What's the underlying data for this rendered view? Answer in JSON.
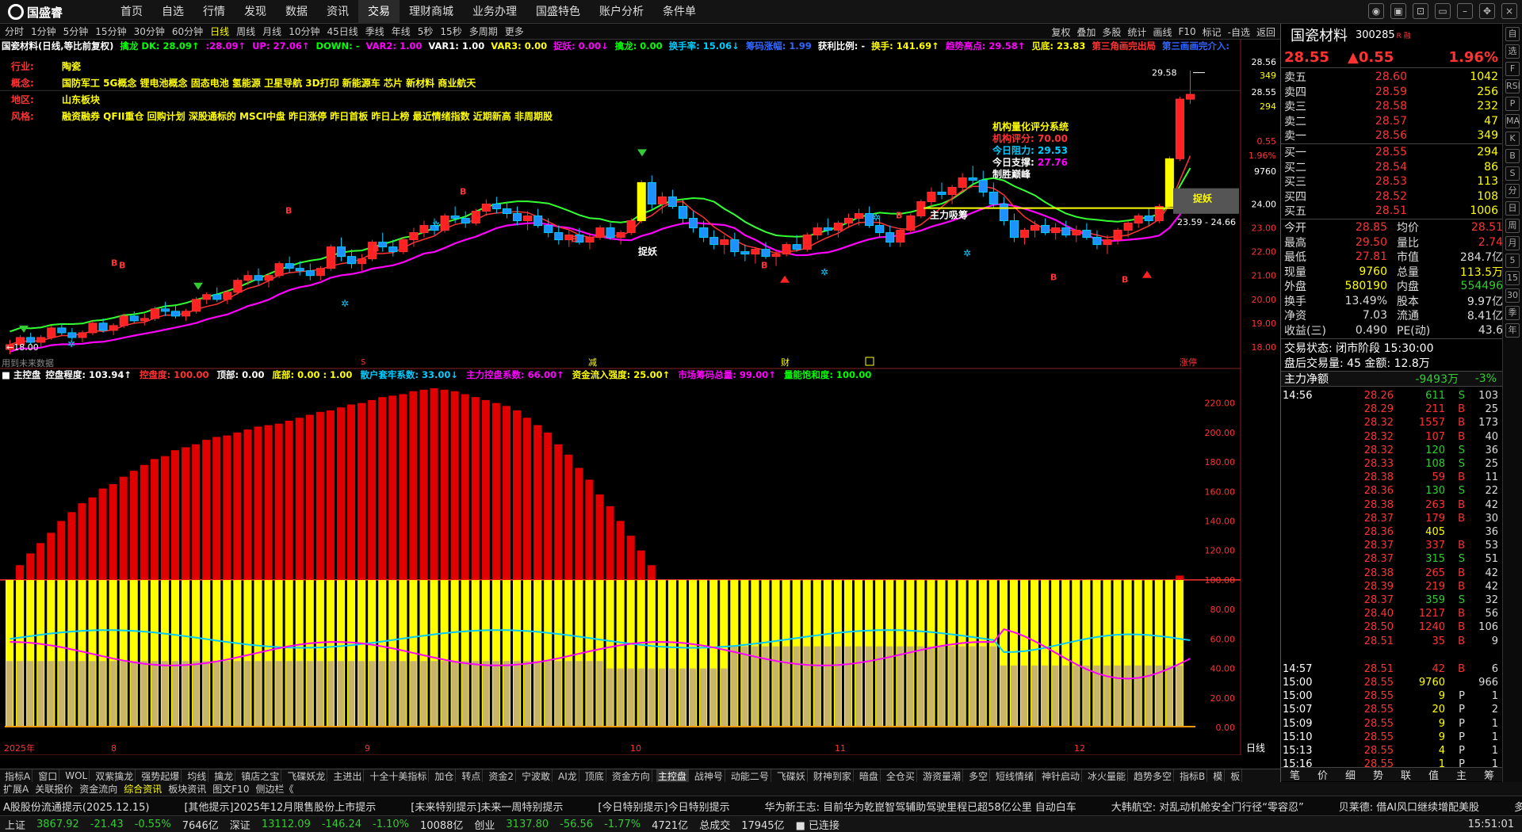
{
  "app": {
    "name": "国盛睿"
  },
  "menu": [
    "首页",
    "自选",
    "行情",
    "发现",
    "数据",
    "资讯",
    "交易",
    "理财商城",
    "业务办理",
    "国盛特色",
    "账户分析",
    "条件单"
  ],
  "menu_active": "交易",
  "periods": [
    "分时",
    "1分钟",
    "5分钟",
    "15分钟",
    "30分钟",
    "60分钟",
    "日线",
    "周线",
    "月线",
    "10分钟",
    "45日线",
    "季线",
    "年线",
    "5秒",
    "15秒",
    "多周期",
    "更多"
  ],
  "period_active": "日线",
  "chart_buttons": [
    "复权",
    "叠加",
    "多股",
    "统计",
    "画线",
    "F10",
    "标记",
    "-自选",
    "返回"
  ],
  "chart_title": "国瓷材料(日线,等比前复权)",
  "indicators": [
    {
      "t": "擒龙 DK: 28.09↑",
      "c": "#0f0"
    },
    {
      "t": ":28.09↑",
      "c": "#f0f"
    },
    {
      "t": "UP: 27.06↑",
      "c": "#f0f"
    },
    {
      "t": "DOWN: -",
      "c": "#0f0"
    },
    {
      "t": "VAR2: 1.00",
      "c": "#f0f"
    },
    {
      "t": "VAR1: 1.00",
      "c": "#fff"
    },
    {
      "t": "VAR3: 0.00",
      "c": "#ff0"
    },
    {
      "t": "捉妖: 0.00↓",
      "c": "#f0f"
    },
    {
      "t": "擒龙: 0.00",
      "c": "#0f0"
    },
    {
      "t": "换手率: 15.06↓",
      "c": "#0cf"
    },
    {
      "t": "筹码涨幅: 1.99",
      "c": "#36f"
    },
    {
      "t": "获利比例: -",
      "c": "#fff"
    },
    {
      "t": "换手: 141.69↑",
      "c": "#ff0"
    },
    {
      "t": "趋势高点: 29.58↑",
      "c": "#f0f"
    },
    {
      "t": "见底: 23.83",
      "c": "#ff0"
    },
    {
      "t": "第三角画完出局",
      "c": "#f33"
    },
    {
      "t": "第三画画完介入:",
      "c": "#36f"
    }
  ],
  "stock_info": [
    {
      "k": "行业:",
      "v": "陶瓷"
    },
    {
      "k": "概念:",
      "v": "国防军工 5G概念 锂电池概念 固态电池 氢能源 卫星导航 3D打印 新能源车 芯片 新材料 商业航天"
    },
    {
      "k": "地区:",
      "v": "山东板块"
    },
    {
      "k": "风格:",
      "v": "融资融券 QFII重仓 回购计划 深股通标的 MSCI中盘 昨日涨停 昨日首板 昨日上榜 最近情绪指数 近期新高 非周期股"
    }
  ],
  "rating": {
    "title": "机构量化评分系统",
    "score_label": "机构评分:",
    "score": "70.00",
    "res_label": "今日阻力:",
    "res": "29.53",
    "sup_label": "今日支撑:",
    "sup": "27.76",
    "name": "制胜巅峰"
  },
  "annotations": {
    "main_lab": "主力吸筹",
    "zy": "捉妖",
    "high": "29.58",
    "low_left": "18.00",
    "range": "23.59 - 24.66",
    "future": "用到未来数据",
    "zt": "涨停",
    "jian": "减",
    "cai": "财"
  },
  "sub_title": "主控盘",
  "sub_indicators": [
    {
      "t": "控盘程度: 103.94↑",
      "c": "#fff"
    },
    {
      "t": "控盘度: 100.00",
      "c": "#f33"
    },
    {
      "t": "顶部: 0.00",
      "c": "#fff"
    },
    {
      "t": "底部: 0.00 : 1.00",
      "c": "#ff0"
    },
    {
      "t": "散户套牢系数: 33.00↓",
      "c": "#0cf"
    },
    {
      "t": "主力控盘系数: 66.00↑",
      "c": "#f0f"
    },
    {
      "t": "资金流入强度: 25.00↑",
      "c": "#ff0"
    },
    {
      "t": "市场筹码总量: 99.00↑",
      "c": "#f0f"
    },
    {
      "t": "量能饱和度: 100.00",
      "c": "#0f0"
    }
  ],
  "price_axis": [
    "28.56",
    "349",
    "28.55",
    "294",
    "0.55",
    "1.96%",
    "9760",
    "24.00",
    "23.00",
    "22.00",
    "21.00",
    "20.00",
    "19.00",
    "18.00"
  ],
  "sub_axis": [
    "220.00",
    "200.00",
    "180.00",
    "160.00",
    "140.00",
    "120.00",
    "100.00",
    "80.00",
    "60.00",
    "40.00",
    "20.00",
    "0.00"
  ],
  "dates": [
    "2025年",
    "8",
    "9",
    "10",
    "11",
    "12"
  ],
  "period_label": "日线",
  "chart_data": {
    "type": "candlestick",
    "title": "国瓷材料(日线,等比前复权)",
    "ylim": [
      17.6,
      29.9
    ],
    "ohlc": [
      [
        17.9,
        18.3,
        17.7,
        18.1
      ],
      [
        18.1,
        18.5,
        18,
        18.4
      ],
      [
        18.4,
        18.6,
        18.1,
        18.2
      ],
      [
        18.2,
        18.5,
        18,
        18.4
      ],
      [
        18.4,
        18.9,
        18.3,
        18.8
      ],
      [
        18.8,
        19,
        18.5,
        18.6
      ],
      [
        18.6,
        18.8,
        18.3,
        18.4
      ],
      [
        18.4,
        18.7,
        18.2,
        18.6
      ],
      [
        18.6,
        19.1,
        18.5,
        19
      ],
      [
        19,
        19.2,
        18.6,
        18.7
      ],
      [
        18.7,
        19,
        18.5,
        18.9
      ],
      [
        18.9,
        19.4,
        18.8,
        19.3
      ],
      [
        19.3,
        19.5,
        19,
        19.1
      ],
      [
        19.1,
        19.4,
        18.9,
        19.2
      ],
      [
        19.2,
        19.7,
        19.1,
        19.6
      ],
      [
        19.6,
        19.9,
        19.3,
        19.5
      ],
      [
        19.5,
        19.8,
        19.2,
        19.3
      ],
      [
        19.3,
        19.6,
        19.1,
        19.5
      ],
      [
        19.5,
        20.1,
        19.4,
        20
      ],
      [
        20,
        20.3,
        19.8,
        20.2
      ],
      [
        20.2,
        20.5,
        19.9,
        20
      ],
      [
        20,
        20.4,
        19.8,
        20.3
      ],
      [
        20.3,
        20.9,
        20.2,
        20.8
      ],
      [
        20.8,
        21.2,
        20.6,
        21
      ],
      [
        21,
        21.3,
        20.6,
        20.8
      ],
      [
        20.8,
        21.1,
        20.5,
        21
      ],
      [
        21,
        21.6,
        20.9,
        21.5
      ],
      [
        21.5,
        21.8,
        21.1,
        21.3
      ],
      [
        21.3,
        21.6,
        21,
        21.2
      ],
      [
        21.2,
        21.5,
        20.8,
        21
      ],
      [
        21,
        21.4,
        20.8,
        21.3
      ],
      [
        21.3,
        22.3,
        21.2,
        22.2
      ],
      [
        22.2,
        22.6,
        21.6,
        21.8
      ],
      [
        21.8,
        22.1,
        21.3,
        21.5
      ],
      [
        21.5,
        21.9,
        21.2,
        21.7
      ],
      [
        21.7,
        22.5,
        21.6,
        22.4
      ],
      [
        22.4,
        22.8,
        22,
        22.2
      ],
      [
        22.2,
        22.5,
        21.8,
        22
      ],
      [
        22,
        22.6,
        21.9,
        22.5
      ],
      [
        22.5,
        23,
        22.2,
        22.8
      ],
      [
        22.8,
        23.3,
        22.6,
        23.1
      ],
      [
        23.1,
        23.4,
        22.7,
        22.9
      ],
      [
        22.9,
        23.6,
        22.8,
        23.5
      ],
      [
        23.5,
        23.9,
        23.2,
        23.4
      ],
      [
        23.4,
        23.7,
        23,
        23.2
      ],
      [
        23.2,
        23.8,
        23.1,
        23.7
      ],
      [
        23.7,
        24.2,
        23.5,
        24
      ],
      [
        24,
        24.3,
        23.6,
        23.8
      ],
      [
        23.8,
        24.1,
        23.4,
        23.6
      ],
      [
        23.6,
        23.9,
        23.1,
        23.3
      ],
      [
        23.3,
        23.7,
        22.9,
        23.5
      ],
      [
        23.5,
        23.8,
        23,
        23.1
      ],
      [
        23.1,
        23.4,
        22.6,
        22.8
      ],
      [
        22.8,
        23.1,
        22.3,
        22.5
      ],
      [
        22.5,
        22.9,
        22.2,
        22.7
      ],
      [
        22.7,
        23,
        22.3,
        22.4
      ],
      [
        22.4,
        22.8,
        22.1,
        22.6
      ],
      [
        22.6,
        23.1,
        22.5,
        23
      ],
      [
        23,
        23.2,
        22.5,
        22.6
      ],
      [
        22.6,
        22.9,
        22.3,
        22.8
      ],
      [
        22.8,
        23.4,
        22.7,
        23.3
      ],
      [
        23.3,
        25,
        23.2,
        24.9
      ],
      [
        24.9,
        25.2,
        23.8,
        24
      ],
      [
        24,
        24.5,
        23.6,
        24.3
      ],
      [
        24.3,
        24.6,
        23.8,
        23.9
      ],
      [
        23.9,
        24.2,
        23.2,
        23.4
      ],
      [
        23.4,
        23.7,
        22.8,
        23
      ],
      [
        23,
        23.3,
        22.4,
        22.6
      ],
      [
        22.6,
        22.9,
        22.1,
        22.3
      ],
      [
        22.3,
        22.7,
        21.9,
        22.5
      ],
      [
        22.5,
        22.8,
        21.8,
        22
      ],
      [
        22,
        22.3,
        21.6,
        21.9
      ],
      [
        21.9,
        22.2,
        21.5,
        22.1
      ],
      [
        22.1,
        22.4,
        21.7,
        21.8
      ],
      [
        21.8,
        22.1,
        21.4,
        21.9
      ],
      [
        21.9,
        22.4,
        21.8,
        22.3
      ],
      [
        22.3,
        22.7,
        22,
        22.1
      ],
      [
        22.1,
        22.8,
        22,
        22.7
      ],
      [
        22.7,
        23.2,
        22.5,
        23
      ],
      [
        23,
        23.4,
        22.7,
        22.9
      ],
      [
        22.9,
        23.3,
        22.6,
        23.2
      ],
      [
        23.2,
        23.6,
        23,
        23.4
      ],
      [
        23.4,
        23.8,
        23.1,
        23.6
      ],
      [
        23.6,
        23.9,
        23,
        23.1
      ],
      [
        23.1,
        23.5,
        22.6,
        22.8
      ],
      [
        22.8,
        23.1,
        22.2,
        22.4
      ],
      [
        22.4,
        23,
        22.2,
        22.9
      ],
      [
        22.9,
        23.6,
        22.8,
        23.5
      ],
      [
        23.5,
        24.2,
        23.4,
        24.1
      ],
      [
        24.1,
        24.7,
        23.9,
        24.5
      ],
      [
        24.5,
        24.9,
        24.2,
        24.4
      ],
      [
        24.4,
        24.8,
        24,
        24.7
      ],
      [
        24.7,
        25.3,
        24.5,
        25.1
      ],
      [
        25.1,
        25.6,
        24.8,
        25
      ],
      [
        25,
        25.4,
        24.3,
        24.5
      ],
      [
        24.5,
        24.9,
        23.8,
        24
      ],
      [
        24,
        24.3,
        23.1,
        23.3
      ],
      [
        23.3,
        23.6,
        22.4,
        22.6
      ],
      [
        22.6,
        23,
        22.3,
        22.9
      ],
      [
        22.9,
        23.3,
        22.6,
        23.1
      ],
      [
        23.1,
        23.4,
        22.7,
        22.8
      ],
      [
        22.8,
        23.2,
        22.5,
        23
      ],
      [
        23,
        23.3,
        22.6,
        22.7
      ],
      [
        22.7,
        23.1,
        22.4,
        22.9
      ],
      [
        22.9,
        23.2,
        22.5,
        22.6
      ],
      [
        22.6,
        22.9,
        22.1,
        22.3
      ],
      [
        22.3,
        22.7,
        21.9,
        22.5
      ],
      [
        22.5,
        23,
        22.3,
        22.9
      ],
      [
        22.9,
        23.3,
        22.6,
        23.2
      ],
      [
        23.2,
        23.6,
        23,
        23.5
      ],
      [
        23.5,
        23.8,
        23.1,
        23.3
      ],
      [
        23.3,
        24,
        23.2,
        23.9
      ],
      [
        23.9,
        26,
        23.8,
        25.9
      ],
      [
        25.9,
        28.5,
        25.8,
        28.4
      ],
      [
        28.4,
        29.6,
        28.2,
        28.6
      ]
    ],
    "main_bars": [
      0,
      0,
      0,
      0,
      0,
      0,
      0,
      0,
      0,
      0,
      0,
      0,
      0,
      0,
      0,
      0,
      0,
      0,
      0,
      0,
      0,
      0,
      0,
      0,
      0,
      0,
      0,
      0,
      0,
      0,
      0,
      0,
      0,
      0,
      0,
      0,
      0,
      0,
      0,
      0,
      0,
      0,
      0,
      0,
      0,
      0,
      0,
      0,
      0,
      0,
      0,
      0,
      0,
      0,
      0,
      0,
      0,
      0,
      0,
      0,
      0,
      0,
      0,
      0,
      0,
      0,
      0,
      0,
      0,
      0,
      0,
      0,
      0,
      0,
      0,
      0,
      0,
      0,
      0,
      0,
      0,
      0,
      0,
      0,
      0,
      0,
      0,
      0,
      0,
      0,
      0,
      0,
      0,
      0,
      0,
      0,
      0,
      0,
      0,
      0,
      0,
      0,
      0,
      0,
      0,
      0,
      0,
      0,
      0,
      0,
      0,
      0,
      0,
      0,
      0
    ],
    "control_bars": [
      100,
      110,
      118,
      125,
      132,
      140,
      146,
      152,
      156,
      162,
      165,
      170,
      174,
      178,
      182,
      184,
      188,
      190,
      192,
      195,
      197,
      198,
      200,
      202,
      204,
      205,
      206,
      208,
      210,
      212,
      214,
      215,
      217,
      219,
      220,
      222,
      224,
      225,
      226,
      228,
      229,
      230,
      229,
      228,
      226,
      224,
      222,
      220,
      218,
      215,
      210,
      205,
      200,
      192,
      185,
      176,
      168,
      158,
      150,
      140,
      130,
      120,
      110,
      100,
      100,
      100,
      100,
      100,
      100,
      100,
      100,
      100,
      100,
      100,
      100,
      100,
      100,
      100,
      100,
      100,
      100,
      100,
      100,
      100,
      100,
      100,
      100,
      100,
      100,
      100,
      100,
      100,
      100,
      100,
      100,
      100,
      100,
      100,
      100,
      100,
      100,
      100,
      100,
      100,
      100,
      100,
      100,
      100,
      100,
      100,
      100,
      100,
      100,
      103
    ],
    "ylim_sub": [
      0,
      230
    ]
  },
  "sub_chart_data": {
    "type": "bar",
    "ylim": [
      0,
      230
    ],
    "threshold": 100
  },
  "right": {
    "name": "国瓷材料",
    "code": "300285",
    "badges": "R 融",
    "price": "28.55",
    "chg": "▲0.55",
    "pct": "1.96%",
    "asks": [
      [
        "卖五",
        "28.60",
        "1042"
      ],
      [
        "卖四",
        "28.59",
        "256"
      ],
      [
        "卖三",
        "28.58",
        "232"
      ],
      [
        "卖二",
        "28.57",
        "47"
      ],
      [
        "卖一",
        "28.56",
        "349"
      ]
    ],
    "bids": [
      [
        "买一",
        "28.55",
        "294"
      ],
      [
        "买二",
        "28.54",
        "86"
      ],
      [
        "买三",
        "28.53",
        "113"
      ],
      [
        "买四",
        "28.52",
        "108"
      ],
      [
        "买五",
        "28.51",
        "1006"
      ]
    ],
    "stats": [
      [
        "今开",
        "28.85",
        "均价",
        "28.51"
      ],
      [
        "最高",
        "29.50",
        "量比",
        "2.74"
      ],
      [
        "最低",
        "27.81",
        "市值",
        "284.7亿"
      ],
      [
        "现量",
        "9760",
        "总量",
        "113.5万"
      ],
      [
        "外盘",
        "580190",
        "内盘",
        "554496"
      ],
      [
        "换手",
        "13.49%",
        "股本",
        "9.97亿"
      ],
      [
        "净资",
        "7.03",
        "流通",
        "8.41亿"
      ],
      [
        "收益(三)",
        "0.490",
        "PE(动)",
        "43.6"
      ]
    ],
    "trade_status": "交易状态: 闭市阶段 15:30:00",
    "after_hours": "盘后交易量: 45 金额: 12.8万",
    "flow_label": "主力净额",
    "flow_val": "-9493万",
    "flow_pct": "-3%",
    "ticks": [
      [
        "14:56",
        "28.26",
        "611",
        "S",
        "103"
      ],
      [
        "",
        "28.29",
        "211",
        "B",
        "25"
      ],
      [
        "",
        "28.32",
        "1557",
        "B",
        "173"
      ],
      [
        "",
        "28.32",
        "107",
        "B",
        "40"
      ],
      [
        "",
        "28.32",
        "120",
        "S",
        "36"
      ],
      [
        "",
        "28.33",
        "108",
        "S",
        "25"
      ],
      [
        "",
        "28.38",
        "59",
        "B",
        "11"
      ],
      [
        "",
        "28.36",
        "130",
        "S",
        "22"
      ],
      [
        "",
        "28.38",
        "263",
        "B",
        "42"
      ],
      [
        "",
        "28.37",
        "179",
        "B",
        "30"
      ],
      [
        "",
        "28.36",
        "405",
        "",
        "36"
      ],
      [
        "",
        "28.37",
        "337",
        "B",
        "53"
      ],
      [
        "",
        "28.37",
        "315",
        "S",
        "51"
      ],
      [
        "",
        "28.38",
        "265",
        "B",
        "42"
      ],
      [
        "",
        "28.39",
        "219",
        "B",
        "42"
      ],
      [
        "",
        "28.37",
        "359",
        "S",
        "32"
      ],
      [
        "",
        "28.40",
        "1217",
        "B",
        "56"
      ],
      [
        "",
        "28.50",
        "1240",
        "B",
        "106"
      ],
      [
        "",
        "28.51",
        "35",
        "B",
        "9"
      ],
      [
        "14:57",
        "28.51",
        "42",
        "B",
        "6"
      ],
      [
        "15:00",
        "28.55",
        "9760",
        "",
        "966"
      ],
      [
        "15:00",
        "28.55",
        "9",
        "P",
        "1"
      ],
      [
        "15:07",
        "28.55",
        "20",
        "P",
        "2"
      ],
      [
        "15:09",
        "28.55",
        "9",
        "P",
        "1"
      ],
      [
        "15:10",
        "28.55",
        "9",
        "P",
        "1"
      ],
      [
        "15:13",
        "28.55",
        "4",
        "P",
        "1"
      ],
      [
        "15:16",
        "28.55",
        "1",
        "P",
        "1"
      ]
    ],
    "tabs": [
      "笔",
      "价",
      "细",
      "势",
      "联",
      "值",
      "主",
      "筹"
    ]
  },
  "side_icons": [
    "自",
    "选",
    "F",
    "RSI",
    "P",
    "MA",
    "K",
    "B",
    "S",
    "分",
    "日",
    "周",
    "月",
    "5",
    "15",
    "30",
    "季",
    "年"
  ],
  "bottom_tabs": [
    "指标A",
    "窗口",
    "WOL",
    "双紫擒龙",
    "强势起爆",
    "均线",
    "擒龙",
    "镇店之宝",
    "飞碟妖龙",
    "主进出",
    "十全十美指标",
    "加仓",
    "转点",
    "资金2",
    "宁波敢",
    "AI龙",
    "顶底",
    "资金方向",
    "主控盘",
    "战神号",
    "动能二号",
    "飞碟妖",
    "财神到家",
    "暗盘",
    "全仓买",
    "游资量潮",
    "多空",
    "短线情绪",
    "神针启动",
    "冰火量能",
    "趋势多空",
    "指标B",
    "模",
    "板"
  ],
  "bottom_active": "主控盘",
  "sub_tabs": [
    "扩展A",
    "关联报价",
    "资金流向",
    "综合资讯",
    "板块资讯",
    "图文F10",
    "侧边栏《"
  ],
  "sub_active": "综合资讯",
  "ticker": [
    "A股股份流通提示(2025.12.15)",
    "[其他提示]2025年12月限售股份上市提示",
    "[未来特别提示]未来一周特别提示",
    "[今日特别提示]今日特别提示",
    "华为新王志: 目前华为乾崑智驾辅助驾驶里程已超58亿公里 自动白车",
    "大韩航空: 对乱动机舱安全门行径“零容忍”",
    "贝莱德: 借AI风口继续增配美股",
    "多重催化剂来袭! 卫星"
  ],
  "status": [
    {
      "name": "上证",
      "v": "3867.92",
      "c": "-21.43",
      "p": "-0.55%",
      "a": "7646亿"
    },
    {
      "name": "深证",
      "v": "13112.09",
      "c": "-146.24",
      "p": "-1.10%",
      "a": "10088亿"
    },
    {
      "name": "创业",
      "v": "3137.80",
      "c": "-56.56",
      "p": "-1.77%",
      "a": "4721亿"
    }
  ],
  "total_label": "总成交",
  "total": "17945亿",
  "conn": "已连接",
  "time": "15:51:01",
  "colors": {
    "up": "#ff3333",
    "down": "#33cc33",
    "yellow": "#ffff00",
    "magenta": "#ff00ff",
    "cyan": "#00ccff"
  }
}
